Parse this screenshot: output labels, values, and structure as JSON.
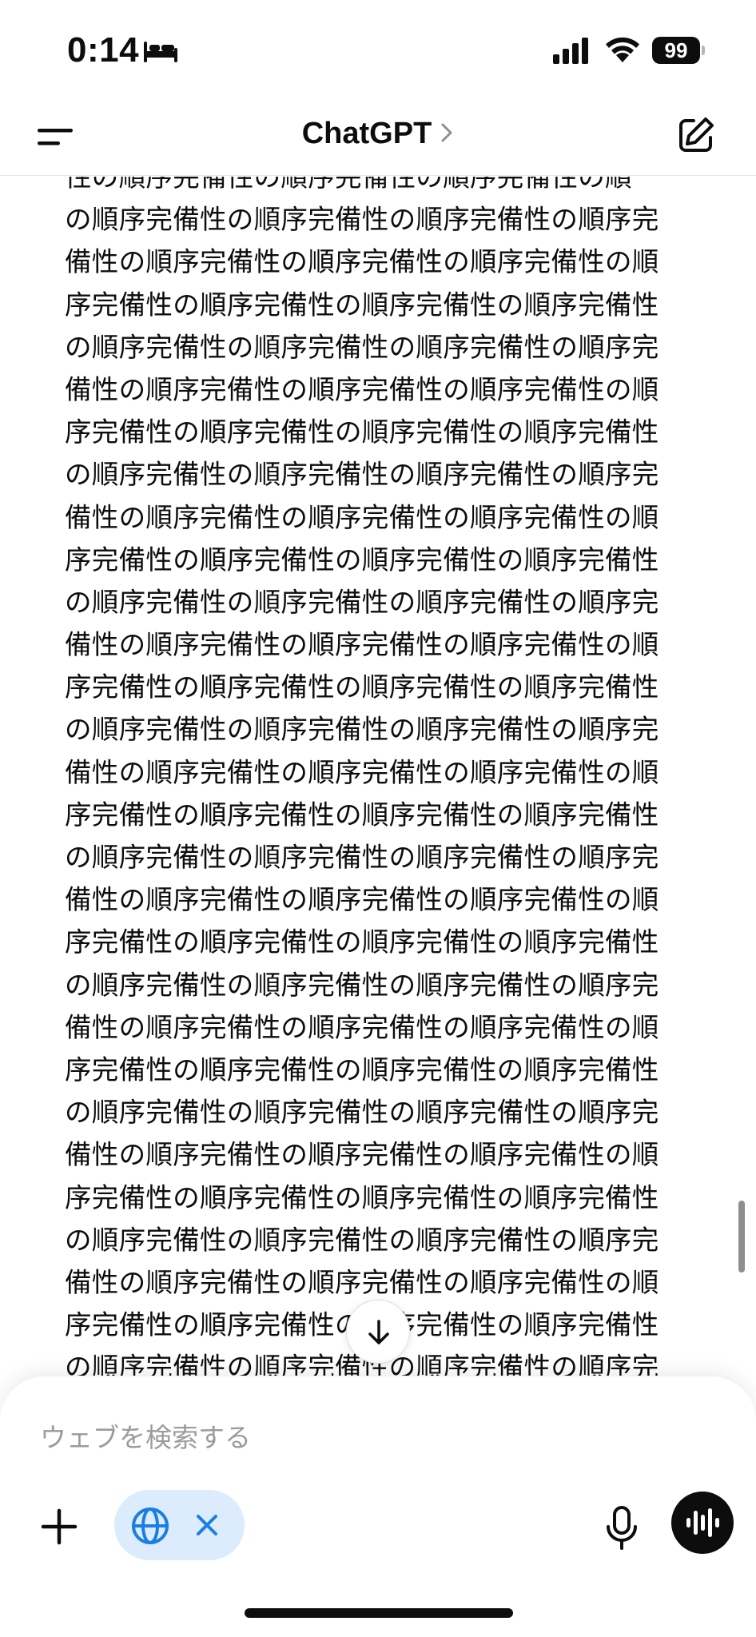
{
  "status_bar": {
    "time": "0:14",
    "battery": "99",
    "icons": [
      "bed-icon",
      "cellular-signal-icon",
      "wifi-icon",
      "battery-icon"
    ]
  },
  "header": {
    "title": "ChatGPT",
    "icons": [
      "menu-icon",
      "chevron-right-icon",
      "new-chat-icon"
    ]
  },
  "content": {
    "lines": [
      "性の順序完備性の順序完備性の順序完備性の順",
      "の順序完備性の順序完備性の順序完備性の順序完",
      "備性の順序完備性の順序完備性の順序完備性の順",
      "序完備性の順序完備性の順序完備性の順序完備性",
      "の順序完備性の順序完備性の順序完備性の順序完",
      "備性の順序完備性の順序完備性の順序完備性の順",
      "序完備性の順序完備性の順序完備性の順序完備性",
      "の順序完備性の順序完備性の順序完備性の順序完",
      "備性の順序完備性の順序完備性の順序完備性の順",
      "序完備性の順序完備性の順序完備性の順序完備性",
      "の順序完備性の順序完備性の順序完備性の順序完",
      "備性の順序完備性の順序完備性の順序完備性の順",
      "序完備性の順序完備性の順序完備性の順序完備性",
      "の順序完備性の順序完備性の順序完備性の順序完",
      "備性の順序完備性の順序完備性の順序完備性の順",
      "序完備性の順序完備性の順序完備性の順序完備性",
      "の順序完備性の順序完備性の順序完備性の順序完",
      "備性の順序完備性の順序完備性の順序完備性の順",
      "序完備性の順序完備性の順序完備性の順序完備性",
      "の順序完備性の順序完備性の順序完備性の順序完",
      "備性の順序完備性の順序完備性の順序完備性の順",
      "序完備性の順序完備性の順序完備性の順序完備性",
      "の順序完備性の順序完備性の順序完備性の順序完",
      "備性の順序完備性の順序完備性の順序完備性の順",
      "序完備性の順序完備性の順序完備性の順序完備性",
      "の順序完備性の順序完備性の順序完備性の順序完",
      "備性の順序完備性の順序完備性の順序完備性の順",
      "序完備性の順序完備性の順序完備性の順序完備性",
      "の順序完備性の順序完備性の順序完備性の順序完"
    ]
  },
  "scroll_down_icon": "arrow-down-icon",
  "composer": {
    "placeholder": "ウェブを検索する",
    "icons": [
      "plus-icon",
      "globe-icon",
      "close-icon",
      "microphone-icon",
      "voice-waveform-icon"
    ]
  },
  "colors": {
    "text": "#0d0d0d",
    "placeholder": "#9b9b9b",
    "web_chip_bg": "#dcecfd",
    "web_chip_accent": "#1a7fe0",
    "voice_button_bg": "#0d0d0d"
  }
}
